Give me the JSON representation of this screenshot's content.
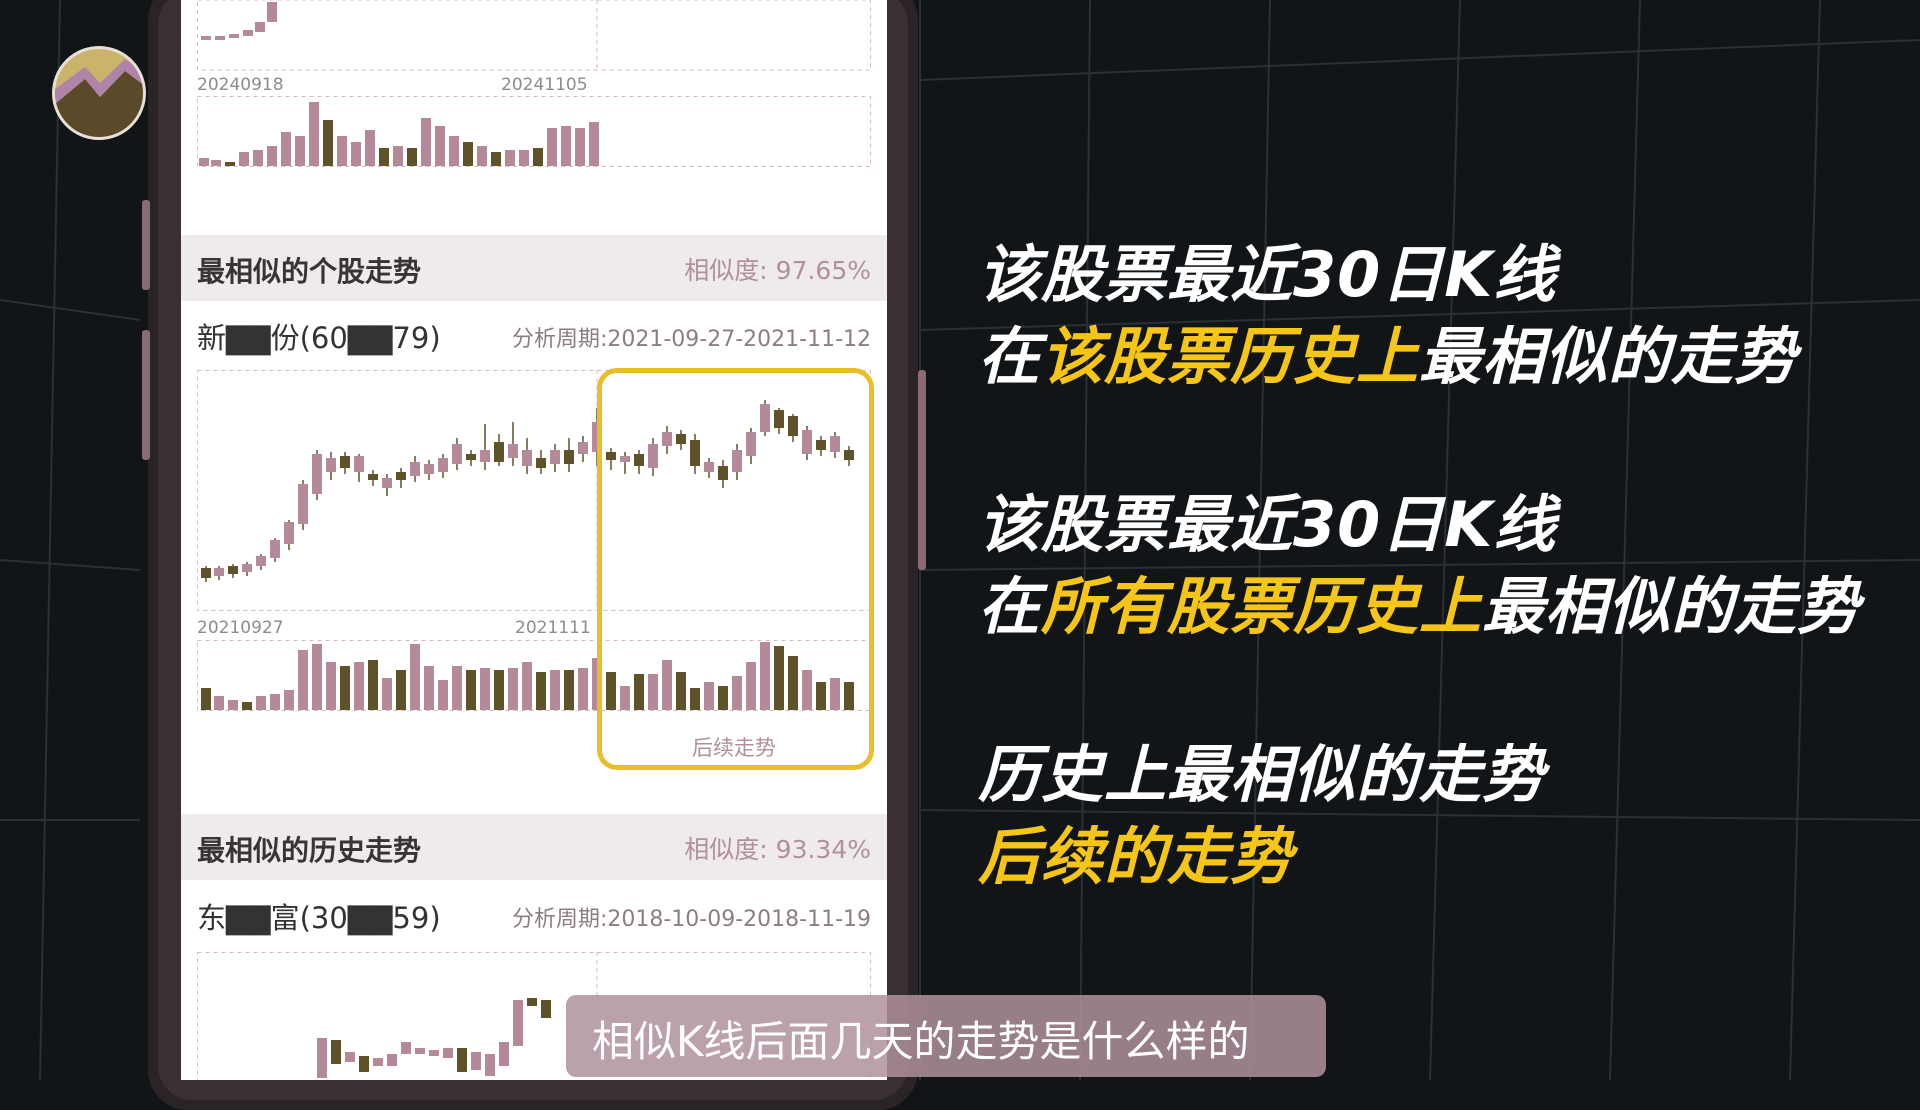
{
  "phone_app": {
    "top_chart": {
      "date_start": "20240918",
      "date_mid": "20241105"
    },
    "stock_section": {
      "title": "最相似的个股走势",
      "similarity": "相似度: 97.65%",
      "stock_name": "新▇▇份(60▇▇79)",
      "period": "分析周期:2021-09-27-2021-11-12",
      "date_start": "20210927",
      "date_mid": "2021111",
      "follow_label": "后续走势"
    },
    "history_section": {
      "title": "最相似的历史走势",
      "similarity": "相似度: 93.34%",
      "stock_name": "东▇▇富(30▇▇59)",
      "period": "分析周期:2018-10-09-2018-11-19"
    }
  },
  "annotations": {
    "line1": "该股票最近30日K线",
    "line2_prefix": "在",
    "line2_highlight": "该股票历史上",
    "line2_suffix": "最相似的走势",
    "line3": "该股票最近30日K线",
    "line4_prefix": "在",
    "line4_highlight": "所有股票历史上",
    "line4_suffix": "最相似的走势",
    "line5": "历史上最相似的走势",
    "line6": "后续的走势"
  },
  "subtitle": "相似K线后面几天的走势是什么样的",
  "colors": {
    "background": "#111518",
    "accent_yellow": "#f5c518",
    "candle_up": "#b48a9a",
    "candle_down": "#5e5228",
    "highlight_box": "#e8bf2a"
  }
}
